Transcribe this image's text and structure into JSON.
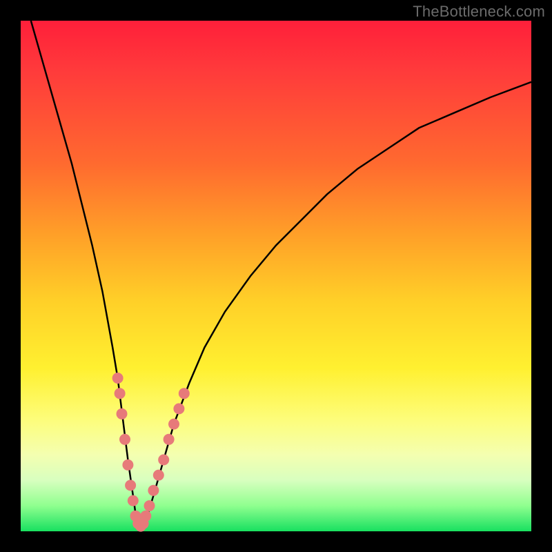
{
  "watermark": "TheBottleneck.com",
  "colors": {
    "background": "#000000",
    "curve": "#000000",
    "marker": "#e77a7a",
    "gradient_top": "#ff1f3a",
    "gradient_bottom": "#18e060"
  },
  "chart_data": {
    "type": "line",
    "title": "",
    "xlabel": "",
    "ylabel": "",
    "xlim": [
      0,
      100
    ],
    "ylim": [
      0,
      100
    ],
    "annotations": [],
    "series": [
      {
        "name": "bottleneck-curve",
        "x": [
          2,
          4,
          6,
          8,
          10,
          12,
          14,
          16,
          18,
          19,
          20,
          21,
          22,
          22.7,
          23.5,
          24.5,
          26,
          28,
          30,
          33,
          36,
          40,
          45,
          50,
          55,
          60,
          66,
          72,
          78,
          85,
          92,
          100
        ],
        "y": [
          100,
          93,
          86,
          79,
          72,
          64,
          56,
          47,
          36,
          30,
          22,
          14,
          7,
          2,
          1,
          2,
          7,
          14,
          21,
          29,
          36,
          43,
          50,
          56,
          61,
          66,
          71,
          75,
          79,
          82,
          85,
          88
        ]
      }
    ],
    "markers": [
      {
        "x": 19.0,
        "y": 30
      },
      {
        "x": 19.4,
        "y": 27
      },
      {
        "x": 19.8,
        "y": 23
      },
      {
        "x": 20.4,
        "y": 18
      },
      {
        "x": 21.0,
        "y": 13
      },
      {
        "x": 21.5,
        "y": 9
      },
      {
        "x": 22.0,
        "y": 6
      },
      {
        "x": 22.5,
        "y": 3
      },
      {
        "x": 23.0,
        "y": 1.5
      },
      {
        "x": 23.5,
        "y": 1
      },
      {
        "x": 24.0,
        "y": 1.5
      },
      {
        "x": 24.5,
        "y": 3
      },
      {
        "x": 25.2,
        "y": 5
      },
      {
        "x": 26.0,
        "y": 8
      },
      {
        "x": 27.0,
        "y": 11
      },
      {
        "x": 28.0,
        "y": 14
      },
      {
        "x": 29.0,
        "y": 18
      },
      {
        "x": 30.0,
        "y": 21
      },
      {
        "x": 31.0,
        "y": 24
      },
      {
        "x": 32.0,
        "y": 27
      }
    ]
  }
}
